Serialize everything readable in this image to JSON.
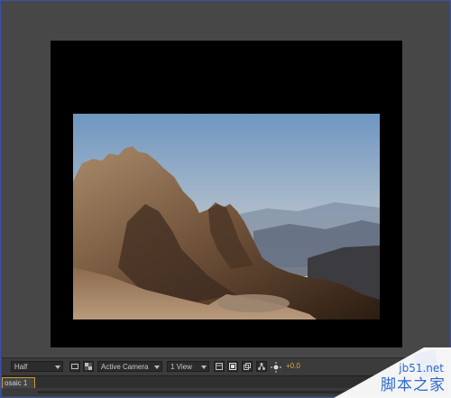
{
  "toolbar": {
    "magnification": "Half",
    "camera": "Active Camera",
    "views": "1 View",
    "exposure": "+0.0",
    "icons": [
      "region-of-interest-icon",
      "transparency-grid-icon",
      "fast-previews-icon",
      "toggle-alpha-icon",
      "3d-view-icon",
      "flowchart-icon",
      "exposure-icon"
    ]
  },
  "tab": {
    "label": "osaic 1",
    "close": "×"
  },
  "watermark": {
    "url": "jb51.net",
    "name": "脚本之家"
  },
  "colors": {
    "accent_tab": "#cf9a2e",
    "exposure_text": "#d6b23a",
    "watermark": "#2c6acb"
  }
}
